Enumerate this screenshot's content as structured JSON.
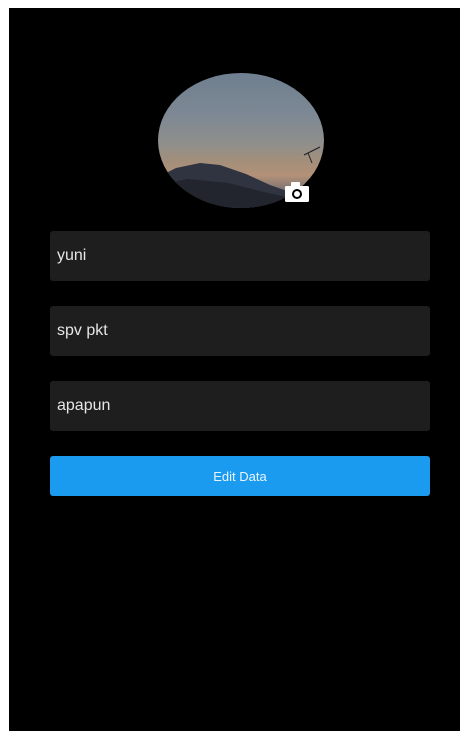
{
  "profile": {
    "photo_icon": "camera-icon",
    "photo_icon_color": "#ffffff"
  },
  "form": {
    "name_value": "yuni",
    "position_value": "spv pkt",
    "extra_value": "apapun"
  },
  "actions": {
    "edit_label": "Edit Data",
    "accent_color": "#1a9bf0"
  }
}
